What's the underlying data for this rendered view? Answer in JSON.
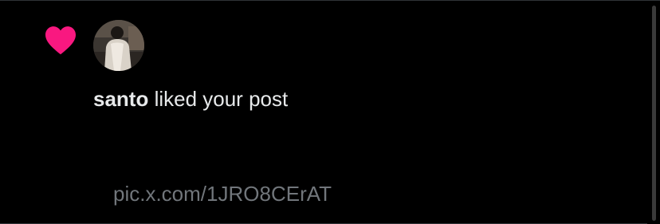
{
  "notification": {
    "icon": "heart-icon",
    "icon_color": "#f91880",
    "avatar": "user-avatar",
    "username": "santo",
    "action_text": " liked your post",
    "post_link": "pic.x.com/1JRO8CErAT"
  },
  "colors": {
    "background": "#000000",
    "text_primary": "#e7e9ea",
    "text_secondary": "#71767b"
  }
}
